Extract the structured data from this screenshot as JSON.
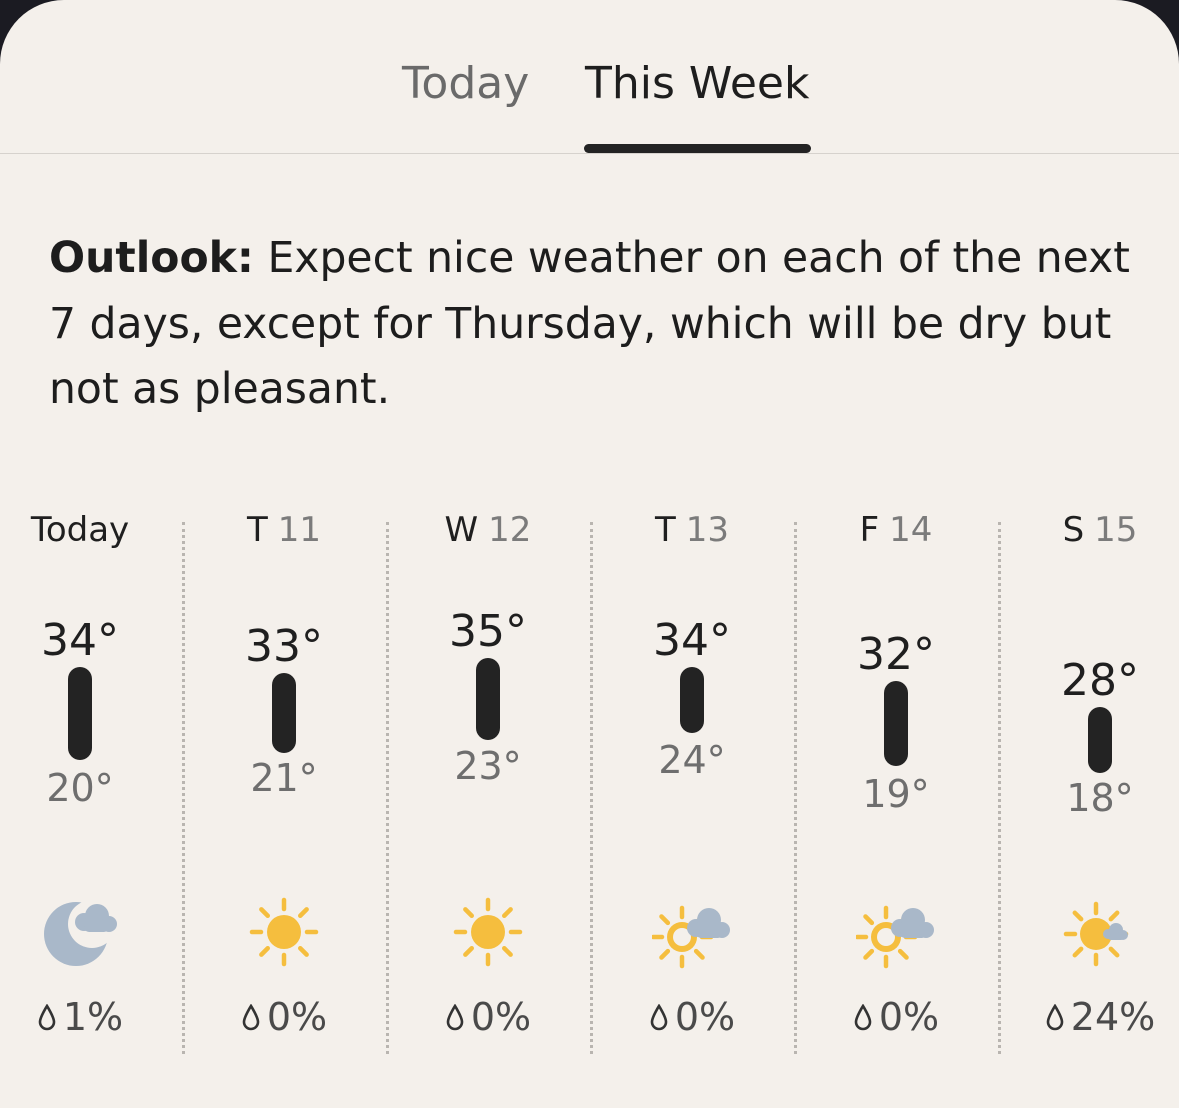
{
  "tabs": {
    "today_label": "Today",
    "week_label": "This Week"
  },
  "outlook": {
    "label": "Outlook:",
    "text": " Expect nice weather on each of the next 7 days, except for Thursday, which will be dry but not as pleasant."
  },
  "colors": {
    "bar": "#232323",
    "sun": "#f5be3e",
    "cloud": "#a9b8c9",
    "moon": "#a9b8c9"
  },
  "days": [
    {
      "label": "Today",
      "date": "",
      "high": "34°",
      "low": "20°",
      "icon": "moon-cloud-icon",
      "precip": "1%"
    },
    {
      "label": "T",
      "date": "11",
      "high": "33°",
      "low": "21°",
      "icon": "sun-icon",
      "precip": "0%"
    },
    {
      "label": "W",
      "date": "12",
      "high": "35°",
      "low": "23°",
      "icon": "sun-icon",
      "precip": "0%"
    },
    {
      "label": "T",
      "date": "13",
      "high": "34°",
      "low": "24°",
      "icon": "partly-cloudy-icon",
      "precip": "0%"
    },
    {
      "label": "F",
      "date": "14",
      "high": "32°",
      "low": "19°",
      "icon": "partly-cloudy-icon",
      "precip": "0%"
    },
    {
      "label": "S",
      "date": "15",
      "high": "28°",
      "low": "18°",
      "icon": "mostly-sunny-icon",
      "precip": "24%"
    }
  ]
}
